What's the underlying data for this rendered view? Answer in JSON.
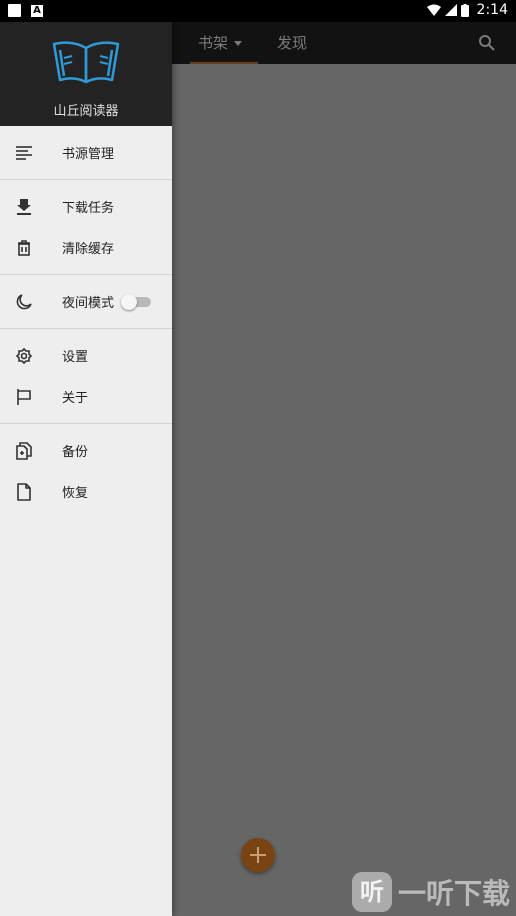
{
  "status_bar": {
    "time": "2:14"
  },
  "app": {
    "tabs": [
      {
        "label": "书架",
        "active": true
      },
      {
        "label": "发现",
        "active": false
      }
    ]
  },
  "drawer": {
    "app_name": "山丘阅读器",
    "sections": [
      [
        {
          "label": "书源管理",
          "icon": "list-icon"
        }
      ],
      [
        {
          "label": "下载任务",
          "icon": "download-icon"
        },
        {
          "label": "清除缓存",
          "icon": "trash-icon"
        }
      ],
      [
        {
          "label": "夜间模式",
          "icon": "moon-icon",
          "toggle": false
        }
      ],
      [
        {
          "label": "设置",
          "icon": "gear-icon"
        },
        {
          "label": "关于",
          "icon": "flag-icon"
        }
      ],
      [
        {
          "label": "备份",
          "icon": "backup-icon"
        },
        {
          "label": "恢复",
          "icon": "file-icon"
        }
      ]
    ]
  },
  "watermark": {
    "badge": "听",
    "text": "一听下载"
  },
  "colors": {
    "drawer_bg": "#eeeeee",
    "header_bg": "#232323",
    "accent": "#7a4412",
    "logo": "#2f9ad8"
  }
}
